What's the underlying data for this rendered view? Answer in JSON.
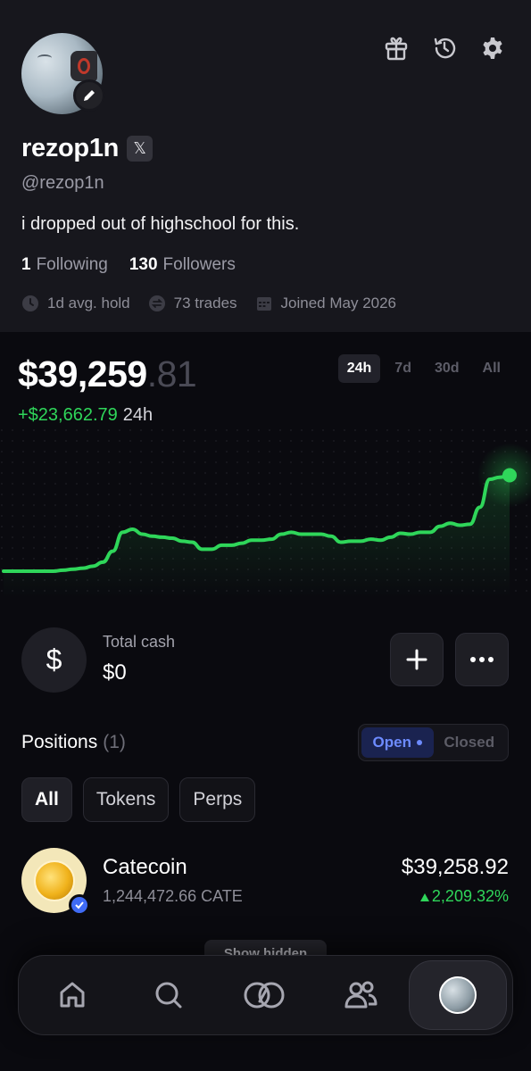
{
  "profile": {
    "username": "rezop1n",
    "x_badge": "𝕏",
    "handle": "@rezop1n",
    "bio": "i dropped out of highschool for this.",
    "following_count": "1",
    "following_label": "Following",
    "followers_count": "130",
    "followers_label": "Followers",
    "avg_hold": "1d avg. hold",
    "trades": "73 trades",
    "joined": "Joined May 2026"
  },
  "header_icons": [
    "gift-icon",
    "history-icon",
    "gear-icon"
  ],
  "portfolio": {
    "balance_main": "$39,259",
    "balance_cents": ".81",
    "pnl": "+$23,662.79",
    "pnl_period": "24h",
    "ranges": [
      "24h",
      "7d",
      "30d",
      "All"
    ],
    "active_range": "24h",
    "accent_color": "#2fd65a"
  },
  "chart_data": {
    "type": "line",
    "title": "",
    "xlabel": "",
    "ylabel": "",
    "values": [
      0.0,
      0.0,
      0.0,
      0.0,
      0.0,
      0.0,
      0.01,
      0.02,
      0.03,
      0.05,
      0.09,
      0.2,
      0.39,
      0.42,
      0.37,
      0.35,
      0.34,
      0.33,
      0.3,
      0.29,
      0.22,
      0.22,
      0.26,
      0.26,
      0.28,
      0.31,
      0.31,
      0.32,
      0.37,
      0.39,
      0.37,
      0.37,
      0.37,
      0.35,
      0.29,
      0.3,
      0.3,
      0.32,
      0.31,
      0.34,
      0.38,
      0.37,
      0.39,
      0.39,
      0.45,
      0.48,
      0.46,
      0.47,
      0.64,
      0.92,
      0.94,
      0.96
    ]
  },
  "cash": {
    "label": "Total cash",
    "value": "$0",
    "icon": "$"
  },
  "positions": {
    "title": "Positions",
    "count": "(1)",
    "toggle_open": "Open",
    "toggle_closed": "Closed",
    "filters": [
      "All",
      "Tokens",
      "Perps"
    ],
    "items": [
      {
        "name": "Catecoin",
        "amount": "1,244,472.66 CATE",
        "value": "$39,258.92",
        "change": "2,209.32%"
      }
    ],
    "show_hidden": "Show hidden"
  },
  "nav": [
    "home-icon",
    "search-icon",
    "swap-icon",
    "people-icon",
    "profile-avatar"
  ]
}
